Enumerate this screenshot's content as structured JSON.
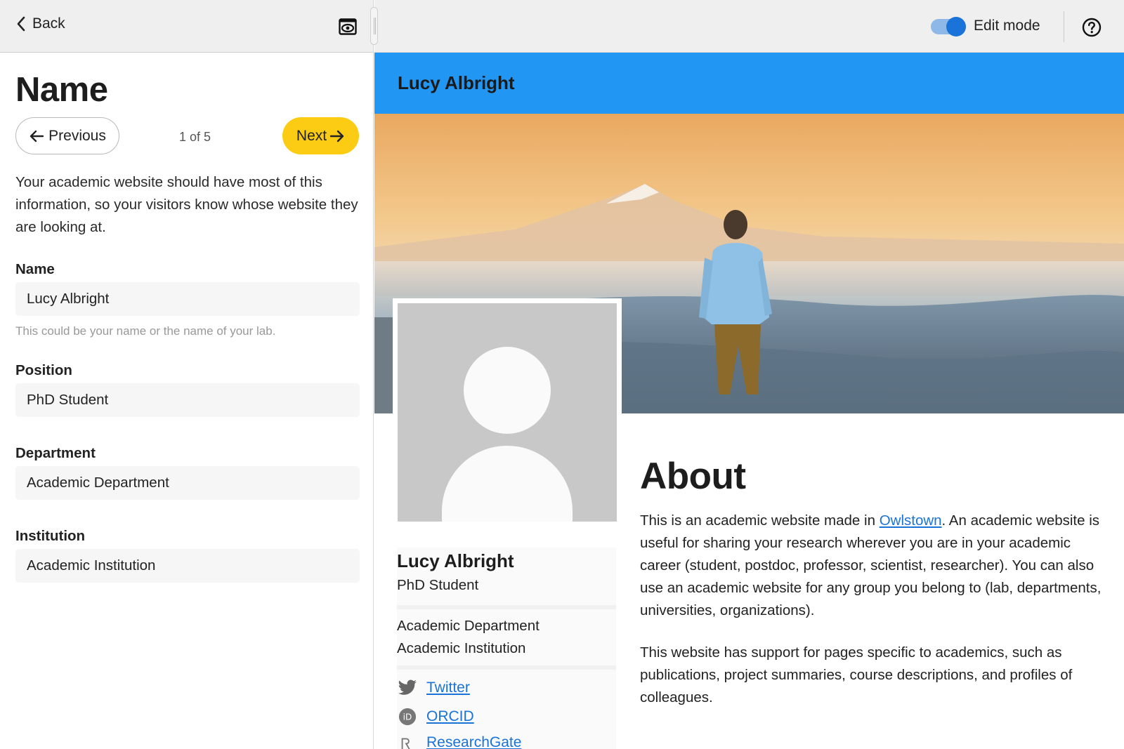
{
  "editor": {
    "back_label": "Back",
    "step_title": "Name",
    "previous_label": "Previous",
    "step_counter": "1 of 5",
    "next_label": "Next",
    "intro": "Your academic website should have most of this information, so your visitors know whose website they are looking at.",
    "fields": {
      "name": {
        "label": "Name",
        "value": "Lucy Albright",
        "hint": "This could be your name or the name of your lab."
      },
      "position": {
        "label": "Position",
        "value": "PhD Student"
      },
      "department": {
        "label": "Department",
        "value": "Academic Department"
      },
      "institution": {
        "label": "Institution",
        "value": "Academic Institution"
      }
    }
  },
  "preview_toolbar": {
    "edit_mode_label": "Edit mode",
    "edit_mode_on": true
  },
  "site": {
    "title": "Lucy Albright",
    "profile": {
      "name": "Lucy Albright",
      "position": "PhD Student",
      "department": "Academic Department",
      "institution": "Academic Institution"
    },
    "social_links": [
      {
        "label": "Twitter",
        "icon": "twitter-icon"
      },
      {
        "label": "ORCID",
        "icon": "orcid-icon"
      },
      {
        "label": "ResearchGate",
        "icon": "researchgate-icon"
      }
    ],
    "about": {
      "heading": "About",
      "p1_before": "This is an academic website made in ",
      "p1_link": "Owlstown",
      "p1_after": ". An academic website is useful for sharing your research wherever you are in your academic career (student, postdoc, professor, scientist, researcher). You can also use an academic website for any group you belong to (lab, departments, universities, organizations).",
      "p2": "This website has support for pages specific to academics, such as publications, project summaries, course descriptions, and profiles of colleagues."
    }
  },
  "colors": {
    "accent_blue": "#2196f3",
    "next_yellow": "#fccc14",
    "link_blue": "#1a73d8"
  }
}
